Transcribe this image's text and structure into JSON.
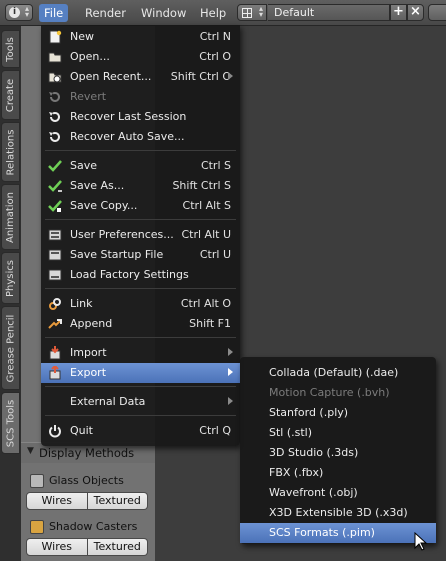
{
  "header": {
    "menus": [
      "File",
      "Render",
      "Window",
      "Help"
    ],
    "layout_name": "Default",
    "layout_add": "+",
    "layout_remove": "×"
  },
  "tabs": [
    "Tools",
    "Create",
    "Relations",
    "Animation",
    "Physics",
    "Grease Pencil",
    "SCS Tools"
  ],
  "toolshelf": {
    "display_methods": "Display Methods",
    "glass_objects": "Glass Objects",
    "shadow_casters": "Shadow Casters",
    "wires": "Wires",
    "textured": "Textured"
  },
  "file_menu": {
    "items": [
      {
        "label": "New",
        "shortcut": "Ctrl N",
        "icon": "new-file-icon"
      },
      {
        "label": "Open...",
        "shortcut": "Ctrl O",
        "icon": "open-folder-icon"
      },
      {
        "label": "Open Recent...",
        "shortcut": "Shift Ctrl O",
        "icon": "open-recent-icon"
      },
      {
        "label": "Revert",
        "shortcut": "",
        "icon": "revert-icon",
        "disabled": true
      },
      {
        "label": "Recover Last Session",
        "shortcut": "",
        "icon": "recover-icon"
      },
      {
        "label": "Recover Auto Save...",
        "shortcut": "",
        "icon": "recover-auto-icon"
      },
      {
        "label": "Save",
        "shortcut": "Ctrl S",
        "icon": "checkmark-icon"
      },
      {
        "label": "Save As...",
        "shortcut": "Shift Ctrl S",
        "icon": "checkmark-dots-icon"
      },
      {
        "label": "Save Copy...",
        "shortcut": "Ctrl Alt S",
        "icon": "save-copy-icon"
      },
      {
        "label": "User Preferences...",
        "shortcut": "Ctrl Alt U",
        "icon": "preferences-icon"
      },
      {
        "label": "Save Startup File",
        "shortcut": "Ctrl U",
        "icon": "save-startup-icon"
      },
      {
        "label": "Load Factory Settings",
        "shortcut": "",
        "icon": "load-factory-icon"
      },
      {
        "label": "Link",
        "shortcut": "Ctrl Alt O",
        "icon": "link-icon"
      },
      {
        "label": "Append",
        "shortcut": "Shift F1",
        "icon": "append-icon"
      },
      {
        "label": "Import",
        "shortcut": "",
        "icon": "import-icon"
      },
      {
        "label": "Export",
        "shortcut": "",
        "icon": "export-icon"
      },
      {
        "label": "External Data",
        "shortcut": "",
        "icon": "external-data-icon"
      },
      {
        "label": "Quit",
        "shortcut": "Ctrl Q",
        "icon": "power-icon"
      }
    ]
  },
  "export_menu": {
    "items": [
      {
        "label": "Collada (Default) (.dae)"
      },
      {
        "label": "Motion Capture (.bvh)",
        "disabled": true
      },
      {
        "label": "Stanford (.ply)"
      },
      {
        "label": "Stl (.stl)"
      },
      {
        "label": "3D Studio (.3ds)"
      },
      {
        "label": "FBX (.fbx)"
      },
      {
        "label": "Wavefront (.obj)"
      },
      {
        "label": "X3D Extensible 3D (.x3d)"
      },
      {
        "label": "SCS Formats (.pim)",
        "highlighted": true
      }
    ]
  },
  "colors": {
    "highlight": "#5680c2",
    "menu_bg": "#181818",
    "panel_bg": "#727272"
  }
}
